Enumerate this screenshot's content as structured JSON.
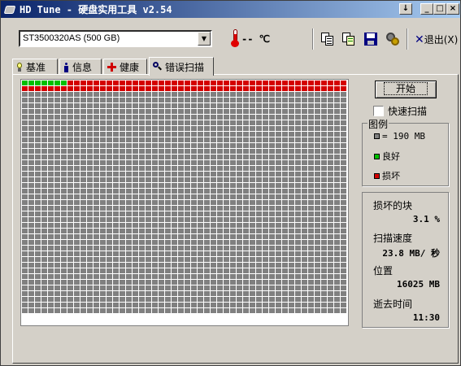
{
  "window": {
    "title": "HD Tune - 硬盘实用工具 v2.54",
    "menu_arrow": "↓",
    "minimize": "_",
    "maximize": "□",
    "close": "×"
  },
  "toolbar": {
    "drive_selected": "ST3500320AS (500 GB)",
    "temperature": "-- ℃",
    "exit_label": "退出(X)"
  },
  "tabs": [
    {
      "label": "基准"
    },
    {
      "label": "信息"
    },
    {
      "label": "健康"
    },
    {
      "label": "错误扫描"
    }
  ],
  "scan": {
    "start_label": "开始",
    "quick_scan_label": "快速扫描",
    "quick_scan_checked": false,
    "grid": {
      "columns": 50,
      "rows": 41,
      "good_blocks": 7,
      "bad_blocks": 93
    },
    "legend": {
      "title": "图例",
      "block_size": "= 190 MB",
      "good_label": "良好",
      "bad_label": "损坏"
    },
    "stats": {
      "damaged_label": "损坏的块",
      "damaged_value": "3.1 %",
      "speed_label": "扫描速度",
      "speed_value": "23.8 MB/ 秒",
      "position_label": "位置",
      "position_value": "16025 MB",
      "elapsed_label": "逝去时间",
      "elapsed_value": "11:30"
    }
  },
  "colors": {
    "untested": "#808080",
    "good": "#00c000",
    "bad": "#d40000",
    "titlebar": "#0a246a"
  }
}
